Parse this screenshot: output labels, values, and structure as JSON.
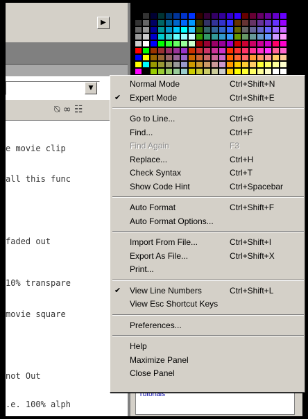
{
  "code_lines": [
    "e movie clip",
    "all this func",
    "faded out",
    "10% transpare",
    "movie square",
    "not Out",
    ".e. 100% alph"
  ],
  "toolbar_icons": "⍉ ∞ ☷",
  "panel": {
    "tutorials": "Tutorials"
  },
  "swatches": {
    "columns": 20,
    "colors": [
      "#000000",
      "#333333",
      "#000033",
      "#003333",
      "#003366",
      "#003399",
      "#0033cc",
      "#0033ff",
      "#330000",
      "#330033",
      "#330066",
      "#330099",
      "#3300cc",
      "#3300ff",
      "#660000",
      "#660033",
      "#660066",
      "#660099",
      "#6600cc",
      "#6600ff",
      "#333333",
      "#666666",
      "#000066",
      "#006666",
      "#006699",
      "#0066cc",
      "#0066ff",
      "#0099ff",
      "#333300",
      "#333366",
      "#333399",
      "#3333cc",
      "#3333ff",
      "#663300",
      "#663333",
      "#663366",
      "#663399",
      "#6633cc",
      "#6633ff",
      "#9900ff",
      "#666666",
      "#999999",
      "#000099",
      "#009999",
      "#0099cc",
      "#00ccff",
      "#00ffff",
      "#33ccff",
      "#336600",
      "#336666",
      "#336699",
      "#3366cc",
      "#3366ff",
      "#666600",
      "#666666",
      "#666699",
      "#6666cc",
      "#6666ff",
      "#9966ff",
      "#cc66ff",
      "#999999",
      "#cccccc",
      "#0000cc",
      "#00cccc",
      "#33cccc",
      "#66ffff",
      "#99ffff",
      "#ccffff",
      "#339900",
      "#339966",
      "#339999",
      "#3399cc",
      "#3399ff",
      "#669900",
      "#669966",
      "#669999",
      "#6699cc",
      "#6699ff",
      "#cc99ff",
      "#ff99ff",
      "#cccccc",
      "#ffffff",
      "#0000ff",
      "#00ff00",
      "#33ff33",
      "#66ff66",
      "#99ff99",
      "#ccffcc",
      "#990000",
      "#990033",
      "#990066",
      "#990099",
      "#9900cc",
      "#cc0000",
      "#cc0033",
      "#cc0066",
      "#cc0099",
      "#cc00cc",
      "#ff0066",
      "#ff00cc",
      "#ff0000",
      "#00ff00",
      "#993300",
      "#993333",
      "#993366",
      "#993399",
      "#9933cc",
      "#cc3300",
      "#cc3333",
      "#cc3366",
      "#cc3399",
      "#cc33cc",
      "#ff3300",
      "#ff3333",
      "#ff3366",
      "#ff3399",
      "#ff33cc",
      "#ff33ff",
      "#ff6699",
      "#ff66cc",
      "#0000ff",
      "#ffff00",
      "#996600",
      "#996633",
      "#996666",
      "#996699",
      "#9966cc",
      "#cc6600",
      "#cc6633",
      "#cc6666",
      "#cc6699",
      "#cc66cc",
      "#ff6600",
      "#ff6633",
      "#ff6666",
      "#ff9933",
      "#ff9966",
      "#ff9999",
      "#ffcc66",
      "#ffcc99",
      "#ffff00",
      "#00ffff",
      "#999900",
      "#999933",
      "#999966",
      "#999999",
      "#9999cc",
      "#cc9900",
      "#cc9933",
      "#cc9966",
      "#cc9999",
      "#cc99cc",
      "#ff9900",
      "#ffcc00",
      "#ffcc33",
      "#ffcc66",
      "#ffff33",
      "#ffff66",
      "#ffff99",
      "#ffffcc",
      "#ff00ff",
      "#000000",
      "#99cc00",
      "#99cc33",
      "#99cc66",
      "#99cc99",
      "#99cccc",
      "#cccc00",
      "#cccc33",
      "#cccc66",
      "#cccc99",
      "#cccccc",
      "#ffcc00",
      "#ffff00",
      "#ffff33",
      "#ffff66",
      "#ffff99",
      "#ffffcc",
      "#ffffff",
      "#ffffff"
    ]
  },
  "menu": {
    "items": [
      {
        "type": "item",
        "check": "",
        "label": "Normal Mode",
        "shortcut": "Ctrl+Shift+N",
        "disabled": false
      },
      {
        "type": "item",
        "check": "✔",
        "label": "Expert Mode",
        "shortcut": "Ctrl+Shift+E",
        "disabled": false
      },
      {
        "type": "sep"
      },
      {
        "type": "item",
        "check": "",
        "label": "Go to Line...",
        "shortcut": "Ctrl+G",
        "disabled": false
      },
      {
        "type": "item",
        "check": "",
        "label": "Find...",
        "shortcut": "Ctrl+F",
        "disabled": false
      },
      {
        "type": "item",
        "check": "",
        "label": "Find Again",
        "shortcut": "F3",
        "disabled": true
      },
      {
        "type": "item",
        "check": "",
        "label": "Replace...",
        "shortcut": "Ctrl+H",
        "disabled": false
      },
      {
        "type": "item",
        "check": "",
        "label": "Check Syntax",
        "shortcut": "Ctrl+T",
        "disabled": false
      },
      {
        "type": "item",
        "check": "",
        "label": "Show Code Hint",
        "shortcut": "Ctrl+Spacebar",
        "disabled": false
      },
      {
        "type": "sep"
      },
      {
        "type": "item",
        "check": "",
        "label": "Auto Format",
        "shortcut": "Ctrl+Shift+F",
        "disabled": false
      },
      {
        "type": "item",
        "check": "",
        "label": "Auto Format Options...",
        "shortcut": "",
        "disabled": false
      },
      {
        "type": "sep"
      },
      {
        "type": "item",
        "check": "",
        "label": "Import From File...",
        "shortcut": "Ctrl+Shift+I",
        "disabled": false
      },
      {
        "type": "item",
        "check": "",
        "label": "Export As File...",
        "shortcut": "Ctrl+Shift+X",
        "disabled": false
      },
      {
        "type": "item",
        "check": "",
        "label": "Print...",
        "shortcut": "",
        "disabled": false
      },
      {
        "type": "sep"
      },
      {
        "type": "item",
        "check": "✔",
        "label": "View Line Numbers",
        "shortcut": "Ctrl+Shift+L",
        "disabled": false
      },
      {
        "type": "item",
        "check": "",
        "label": "View Esc Shortcut Keys",
        "shortcut": "",
        "disabled": false
      },
      {
        "type": "sep"
      },
      {
        "type": "item",
        "check": "",
        "label": "Preferences...",
        "shortcut": "",
        "disabled": false
      },
      {
        "type": "sep"
      },
      {
        "type": "item",
        "check": "",
        "label": "Help",
        "shortcut": "",
        "disabled": false
      },
      {
        "type": "item",
        "check": "",
        "label": "Maximize Panel",
        "shortcut": "",
        "disabled": false
      },
      {
        "type": "item",
        "check": "",
        "label": "Close Panel",
        "shortcut": "",
        "disabled": false
      }
    ]
  }
}
